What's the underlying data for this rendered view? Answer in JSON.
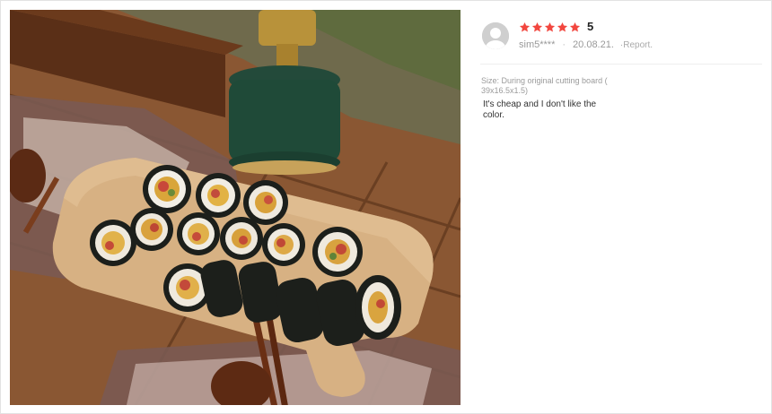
{
  "review": {
    "score": "5",
    "rating": 5,
    "rating_max": 5,
    "username": "sim5****",
    "date": "20.08.21.",
    "separator": "·",
    "report_label": "·Report.",
    "size_text": "Size: During original cutting board ( 39x16.5x1.5)",
    "content": "It's cheap and I don't like the color."
  },
  "colors": {
    "star": "#f2473f",
    "border": "#e3e3e3",
    "muted_text": "#999999"
  },
  "icons": {
    "avatar": "user-avatar-icon",
    "star": "star-icon"
  }
}
